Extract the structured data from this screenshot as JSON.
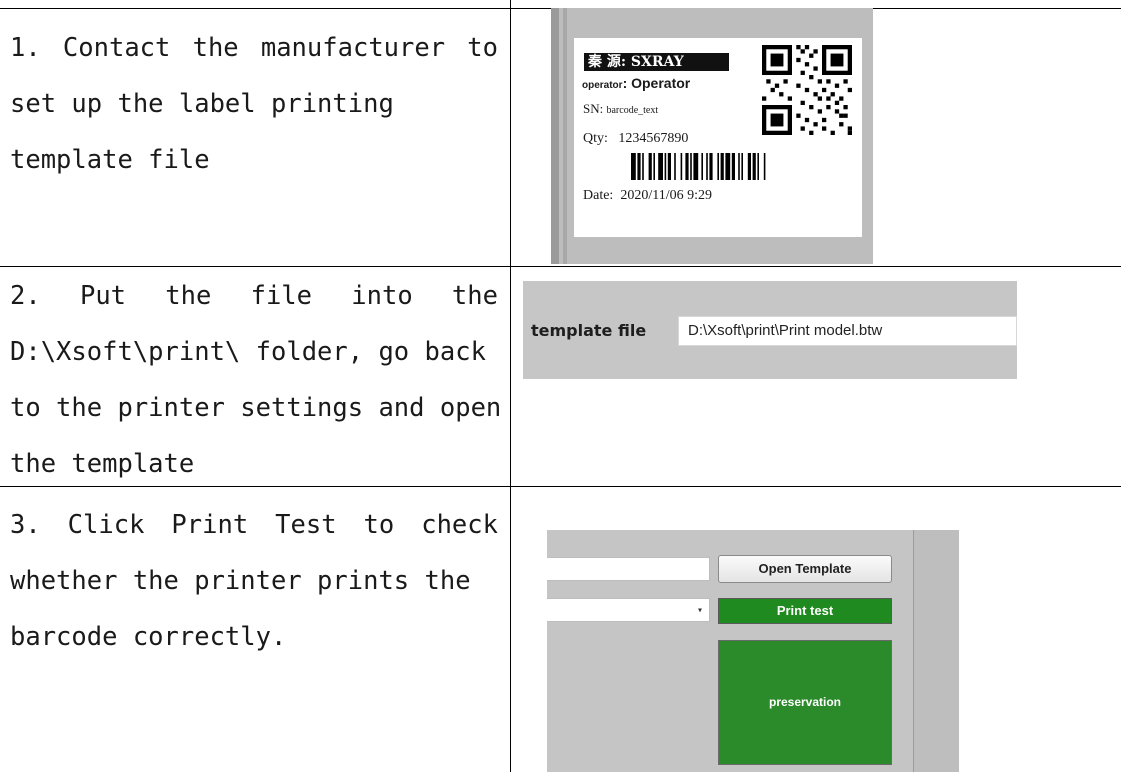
{
  "steps": [
    {
      "lines": [
        "1. Contact the manufacturer to",
        "set up the label printing",
        "template file"
      ]
    },
    {
      "lines": [
        "2.  Put  the  file  into  the",
        "D:\\Xsoft\\print\\ folder, go back",
        "to the printer settings and open",
        "the template"
      ]
    },
    {
      "lines": [
        "3.  Click Print Test to check",
        "whether the printer prints the",
        "barcode correctly."
      ]
    }
  ],
  "label_preview": {
    "header": "秦 源: SXRAY",
    "operator_key": "operator",
    "operator_value": ": Operator",
    "sn_key": "SN:",
    "sn_value": "barcode_text",
    "qty_key": "Qty:",
    "qty_value": "1234567890",
    "date_key": "Date:",
    "date_value": "2020/11/06 9:29"
  },
  "template_field": {
    "label": "template file",
    "value": "D:\\Xsoft\\print\\Print model.btw"
  },
  "buttons": {
    "open_template": "Open Template",
    "print_test": "Print test",
    "preservation": "preservation"
  },
  "colors": {
    "green_button": "#1f8a1f",
    "panel_gray": "#c5c5c5"
  }
}
